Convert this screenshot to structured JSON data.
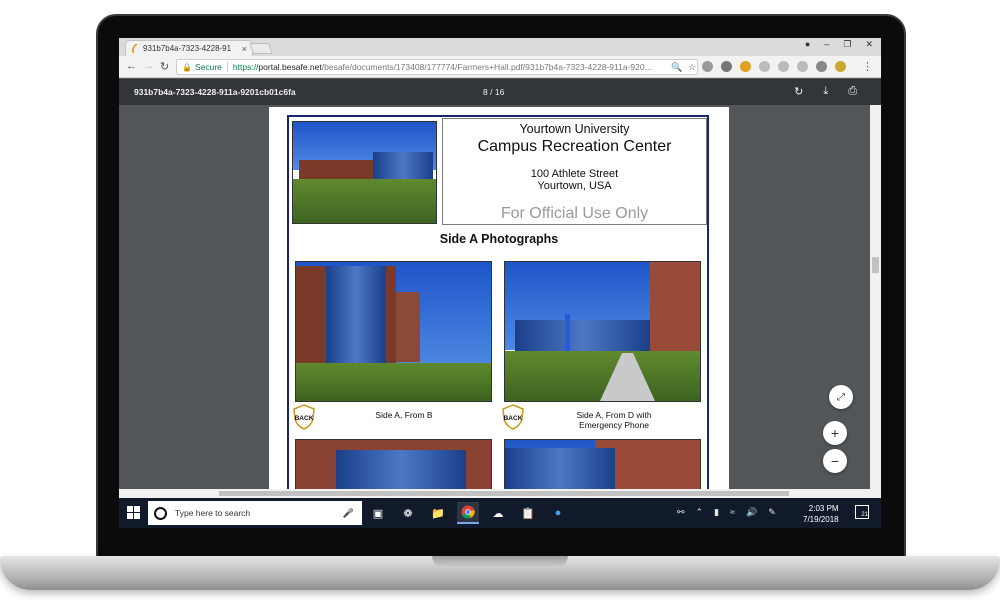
{
  "browser": {
    "tab_title": "931b7b4a-7323-4228-91",
    "tab_close": "×",
    "window_controls": [
      "●",
      "–",
      "❐",
      "✕"
    ],
    "back": "←",
    "forward": "→",
    "reload": "↻",
    "secure_label": "Secure",
    "url_scheme": "https://",
    "url_host": "portal.besafe.net",
    "url_path": "/besafe/documents/173408/177774/Farmers+Hall.pdf/931b7b4a-7323-4228-911a-920...",
    "menu": "⋮"
  },
  "pdf": {
    "file_title": "931b7b4a-7323-4228-911a-9201cb01c6fa",
    "page_current": "8",
    "page_sep": "/",
    "page_total": "16"
  },
  "document": {
    "university": "Yourtown University",
    "center_name": "Campus Recreation Center",
    "street": "100 Athlete Street",
    "city": "Yourtown, USA",
    "official_use": "For Official Use Only",
    "section_title": "Side A Photographs",
    "badge_text": "BACK",
    "photos": [
      {
        "caption_line1": "Side A, From B",
        "caption_line2": ""
      },
      {
        "caption_line1": "Side A, From D with",
        "caption_line2": "Emergency Phone"
      }
    ]
  },
  "viewer_controls": {
    "fit": "⤢",
    "zoom_in": "+",
    "zoom_out": "−"
  },
  "taskbar": {
    "search_placeholder": "Type here to search",
    "time": "2:03 PM",
    "date": "7/19/2018",
    "notification_count": "21"
  },
  "colors": {
    "page_border": "#1a2570",
    "secure_green": "#0b8043",
    "pdf_toolbar": "#323639",
    "viewer_bg": "#525659",
    "taskbar_bg": "#101a2a"
  }
}
